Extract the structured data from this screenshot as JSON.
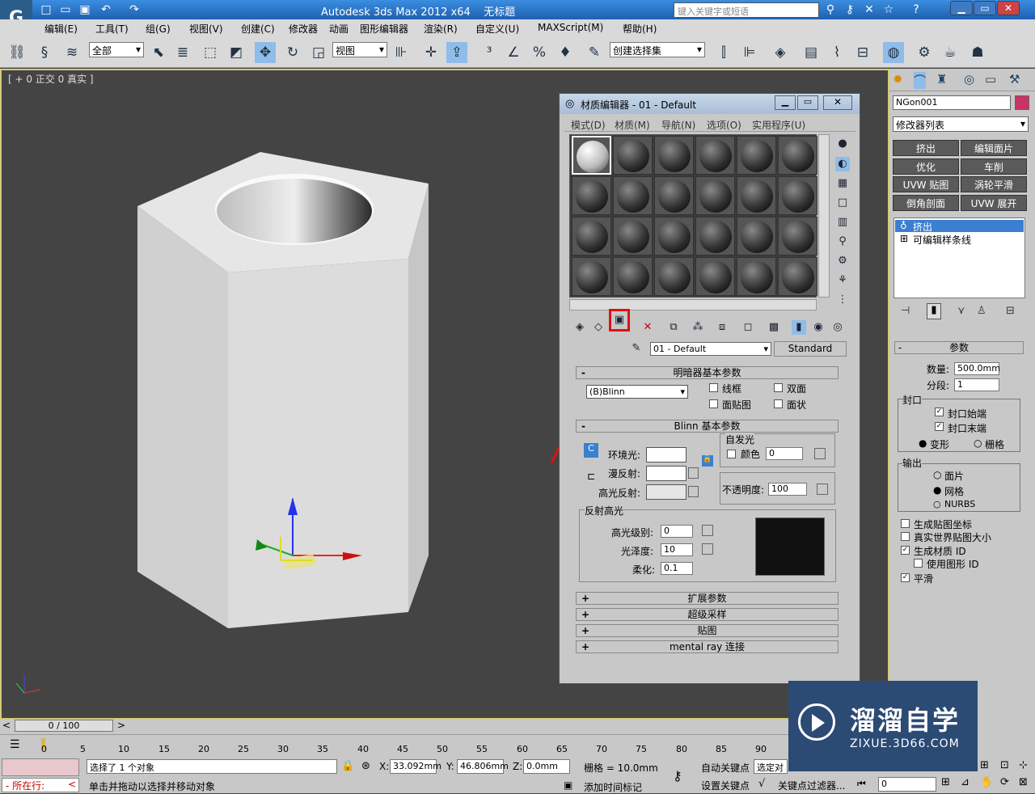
{
  "titlebar": {
    "app": "Autodesk 3ds Max  2012 x64",
    "doc": "无标题",
    "search_placeholder": "键入关键字或短语"
  },
  "menu": [
    "编辑(E)",
    "工具(T)",
    "组(G)",
    "视图(V)",
    "创建(C)",
    "修改器",
    "动画",
    "图形编辑器",
    "渲染(R)",
    "自定义(U)",
    "MAXScript(M)",
    "帮助(H)"
  ],
  "toolbar": {
    "selection_filter": "全部",
    "coord_system": "视图",
    "named_selection": "创建选择集"
  },
  "viewport": {
    "label": "[ + 0 正交 0 真实 ]"
  },
  "material_editor": {
    "title": "材质编辑器 - 01 - Default",
    "menu": [
      "模式(D)",
      "材质(M)",
      "导航(N)",
      "选项(O)",
      "实用程序(U)"
    ],
    "material_name": "01 - Default",
    "material_type": "Standard",
    "shader_section": "明暗器基本参数",
    "shader": "(B)Blinn",
    "shader_opts": [
      "线框",
      "双面",
      "面贴图",
      "面状"
    ],
    "blinn_section": "Blinn 基本参数",
    "self_illum": "自发光",
    "self_illum_color": "颜色",
    "self_illum_value": "0",
    "ambient": "环境光:",
    "diffuse": "漫反射:",
    "specular": "高光反射:",
    "opacity_label": "不透明度:",
    "opacity": "100",
    "spec_section": "反射高光",
    "spec_level_label": "高光级别:",
    "spec_level": "0",
    "gloss_label": "光泽度:",
    "gloss": "10",
    "soften_label": "柔化:",
    "soften": "0.1",
    "rollouts": [
      "扩展参数",
      "超级采样",
      "贴图",
      "mental ray 连接"
    ]
  },
  "command_panel": {
    "object_name": "NGon001",
    "modifier_list": "修改器列表",
    "buttons": [
      "挤出",
      "编辑面片",
      "优化",
      "车削",
      "UVW 贴图",
      "涡轮平滑",
      "倒角剖面",
      "UVW 展开"
    ],
    "stack": [
      "挤出",
      "可编辑样条线"
    ],
    "params_title": "参数",
    "amount_label": "数量:",
    "amount": "500.0mm",
    "segments_label": "分段:",
    "segments": "1",
    "capping": "封口",
    "cap_start": "封口始端",
    "cap_end": "封口末端",
    "morph": "变形",
    "grid": "栅格",
    "output": "输出",
    "patch": "面片",
    "mesh": "网格",
    "nurbs": "NURBS",
    "gen_map_coords": "生成贴图坐标",
    "real_world": "真实世界贴图大小",
    "gen_mat_ids": "生成材质 ID",
    "use_shape_ids": "使用图形 ID",
    "smooth": "平滑"
  },
  "timeline": {
    "frame": "0 / 100",
    "ticks": [
      "0",
      "5",
      "10",
      "15",
      "20",
      "25",
      "30",
      "35",
      "40",
      "45",
      "50",
      "55",
      "60",
      "65",
      "70",
      "75",
      "80",
      "85",
      "90"
    ]
  },
  "status": {
    "selected": "选择了 1 个对象",
    "prompt": "单击并拖动以选择并移动对象",
    "running": "所在行:",
    "x_label": "X:",
    "x": "33.092mm",
    "y_label": "Y:",
    "y": "46.806mm",
    "z_label": "Z:",
    "z": "0.0mm",
    "grid": "栅格 = 10.0mm",
    "auto_key": "自动关键点",
    "set_key": "设置关键点",
    "selected_obj": "选定对",
    "add_time_tag": "添加时间标记",
    "key_filters": "关键点过滤器...",
    "frame_field": "0"
  },
  "watermark": {
    "brand": "溜溜自学",
    "url": "ZIXUE.3D66.COM"
  }
}
